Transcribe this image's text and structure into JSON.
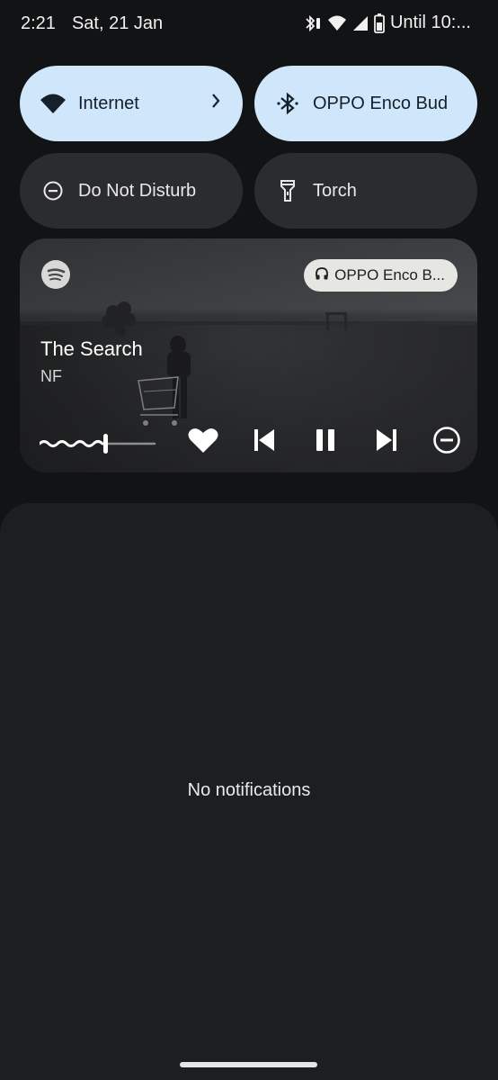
{
  "status_bar": {
    "time": "2:21",
    "date": "Sat, 21 Jan",
    "battery_text": "Until 10:..."
  },
  "tiles": {
    "internet": {
      "label": "Internet",
      "icon": "wifi-icon",
      "state": "on"
    },
    "bluetooth": {
      "label": "OPPO Enco Bud",
      "icon": "bluetooth-icon",
      "state": "on"
    },
    "dnd": {
      "label": "Do Not Disturb",
      "icon": "dnd-icon",
      "state": "off"
    },
    "torch": {
      "label": "Torch",
      "icon": "flashlight-icon",
      "state": "off"
    }
  },
  "media": {
    "app_icon": "spotify-icon",
    "output_device": "OPPO Enco B...",
    "title": "The Search",
    "artist": "NF",
    "progress": 0.55,
    "liked": true,
    "state": "playing"
  },
  "notifications": {
    "empty_text": "No notifications"
  },
  "colors": {
    "tile_on": "#cfe6fb",
    "tile_off": "#2b2c2f",
    "panel_bg": "#1d1e20"
  }
}
